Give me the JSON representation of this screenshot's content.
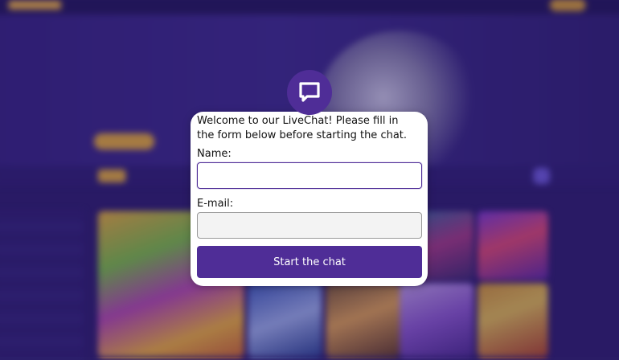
{
  "chat": {
    "welcome": "Welcome to our LiveChat! Please fill in the form below before starting the chat.",
    "name_label": "Name:",
    "name_value": "",
    "email_label": "E-mail:",
    "email_value": "",
    "start_label": "Start the chat",
    "icon": "chat-bubble-icon"
  },
  "colors": {
    "accent": "#4f2d97",
    "page_bg": "#2a1c66",
    "gold": "#f3b830"
  }
}
